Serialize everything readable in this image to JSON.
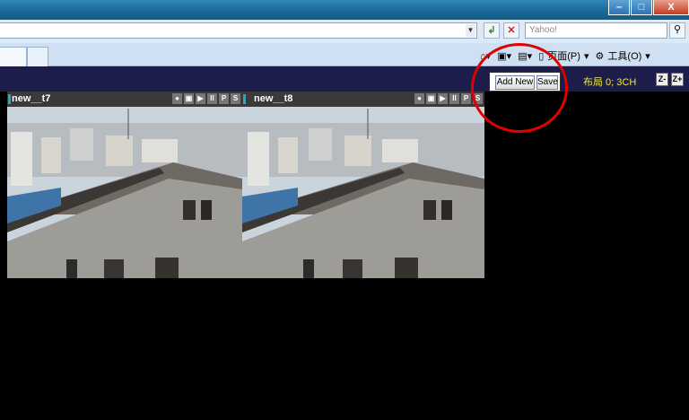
{
  "browser": {
    "window_controls": {
      "minimize": "–",
      "maximize": "□",
      "close": "X"
    },
    "search_placeholder": "Yahoo!",
    "command_bar": {
      "page_label": "页面(P)",
      "tools_label": "工具(O)"
    }
  },
  "app": {
    "add_new_label": "Add New",
    "save_label": "Save",
    "layout_label": "布局 0; 3CH",
    "zoom_out_label": "Z-",
    "zoom_in_label": "Z+"
  },
  "panes": [
    {
      "name": "new__t7",
      "controls": [
        "●",
        "▣",
        "▶",
        "II",
        "P",
        "S"
      ]
    },
    {
      "name": "new__t8",
      "controls": [
        "●",
        "▣",
        "▶",
        "II",
        "P",
        "S"
      ]
    }
  ],
  "colors": {
    "annotation_circle": "#e00000",
    "layout_text": "#f0e64a",
    "app_bar": "#1c1d4a"
  }
}
